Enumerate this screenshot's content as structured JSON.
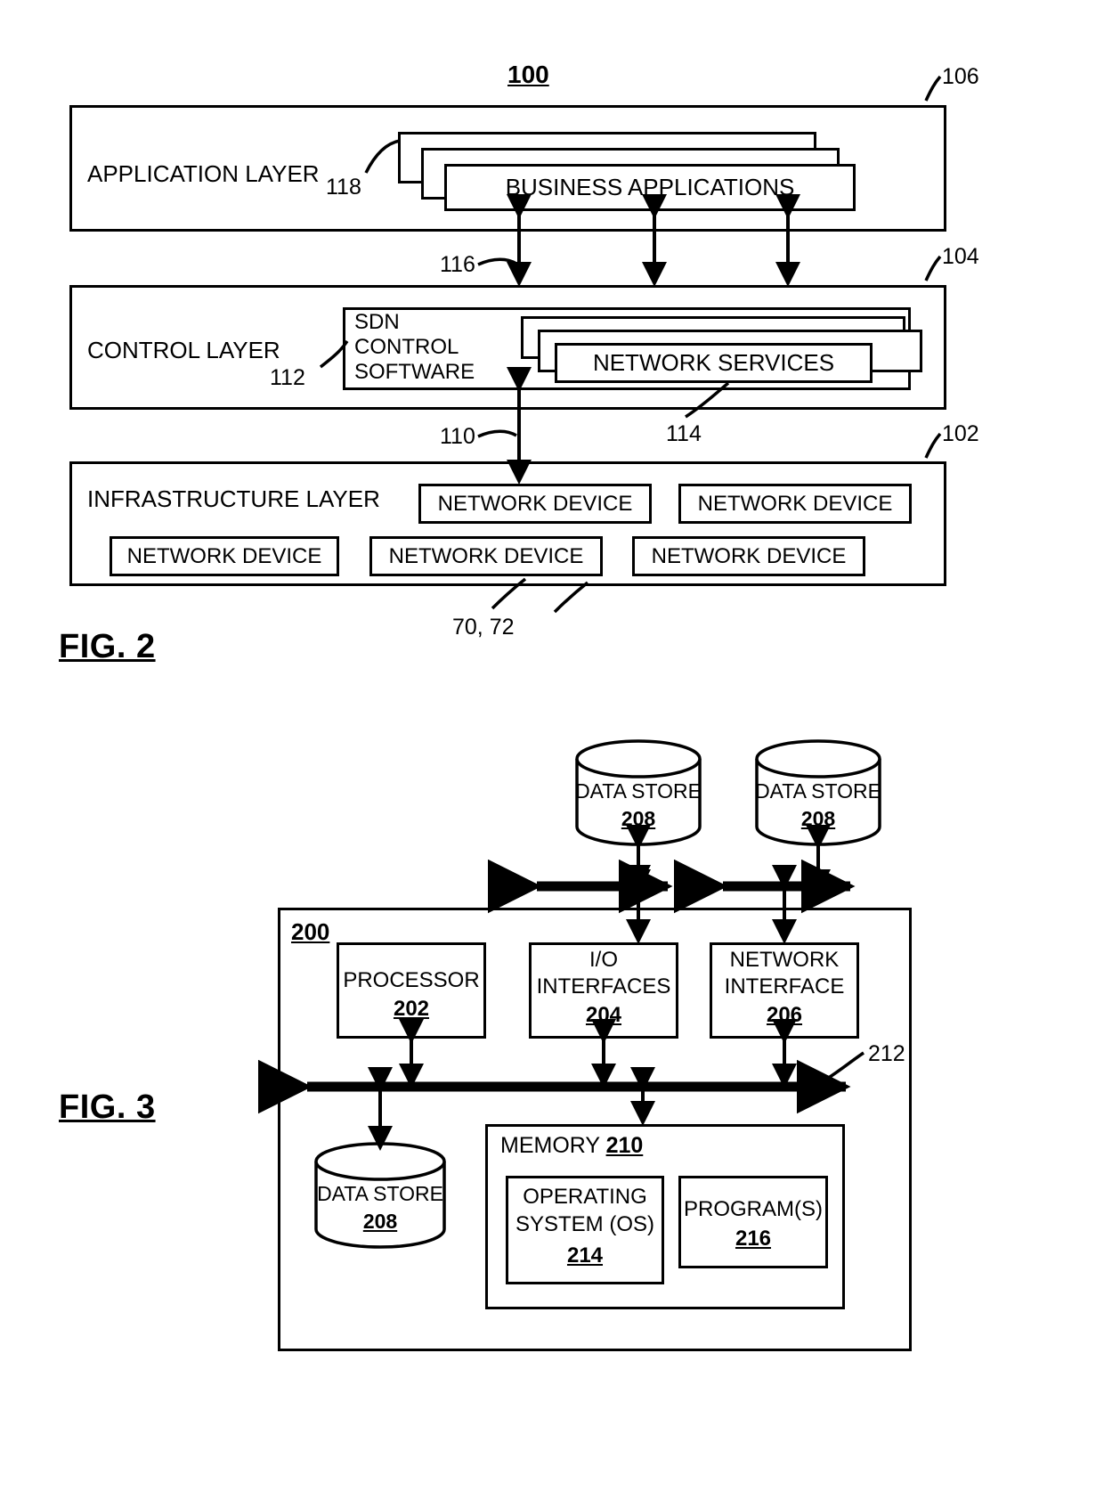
{
  "figures": [
    {
      "id": "fig2",
      "caption": "FIG. 2",
      "top_ref": "100",
      "layers": [
        {
          "name": "application-layer",
          "title": "APPLICATION LAYER",
          "ref": "106",
          "stack": {
            "label": "BUSINESS APPLICATIONS",
            "ref": "118",
            "copies": 3
          }
        },
        {
          "name": "control-layer",
          "title": "CONTROL LAYER",
          "ref": "104",
          "sdn": {
            "label_line1": "SDN",
            "label_line2": "CONTROL",
            "label_line3": "SOFTWARE",
            "ref": "112"
          },
          "stack": {
            "label": "NETWORK SERVICES",
            "ref": "114",
            "copies": 3
          }
        },
        {
          "name": "infrastructure-layer",
          "title": "INFRASTRUCTURE LAYER",
          "ref": "102",
          "devices": [
            "NETWORK DEVICE",
            "NETWORK DEVICE",
            "NETWORK DEVICE",
            "NETWORK DEVICE",
            "NETWORK DEVICE"
          ],
          "devices_ref": "70, 72"
        }
      ],
      "interface_refs": {
        "app_to_control": "116",
        "control_to_infra": "110"
      }
    },
    {
      "id": "fig3",
      "caption": "FIG. 3",
      "system_ref": "200",
      "bus_ref": "212",
      "external_data_stores": [
        {
          "label": "DATA STORE",
          "ref": "208"
        },
        {
          "label": "DATA STORE",
          "ref": "208"
        }
      ],
      "components": [
        {
          "name": "processor",
          "label_line1": "PROCESSOR",
          "label_line2": "",
          "ref": "202"
        },
        {
          "name": "io-interfaces",
          "label_line1": "I/O",
          "label_line2": "INTERFACES",
          "ref": "204"
        },
        {
          "name": "network-interface",
          "label_line1": "NETWORK",
          "label_line2": "INTERFACE",
          "ref": "206"
        }
      ],
      "internal_data_store": {
        "label": "DATA STORE",
        "ref": "208"
      },
      "memory": {
        "label": "MEMORY",
        "ref": "210",
        "items": [
          {
            "name": "operating-system",
            "label_line1": "OPERATING",
            "label_line2": "SYSTEM (OS)",
            "ref": "214"
          },
          {
            "name": "programs",
            "label_line1": "PROGRAM(S)",
            "label_line2": "",
            "ref": "216"
          }
        ]
      }
    }
  ]
}
